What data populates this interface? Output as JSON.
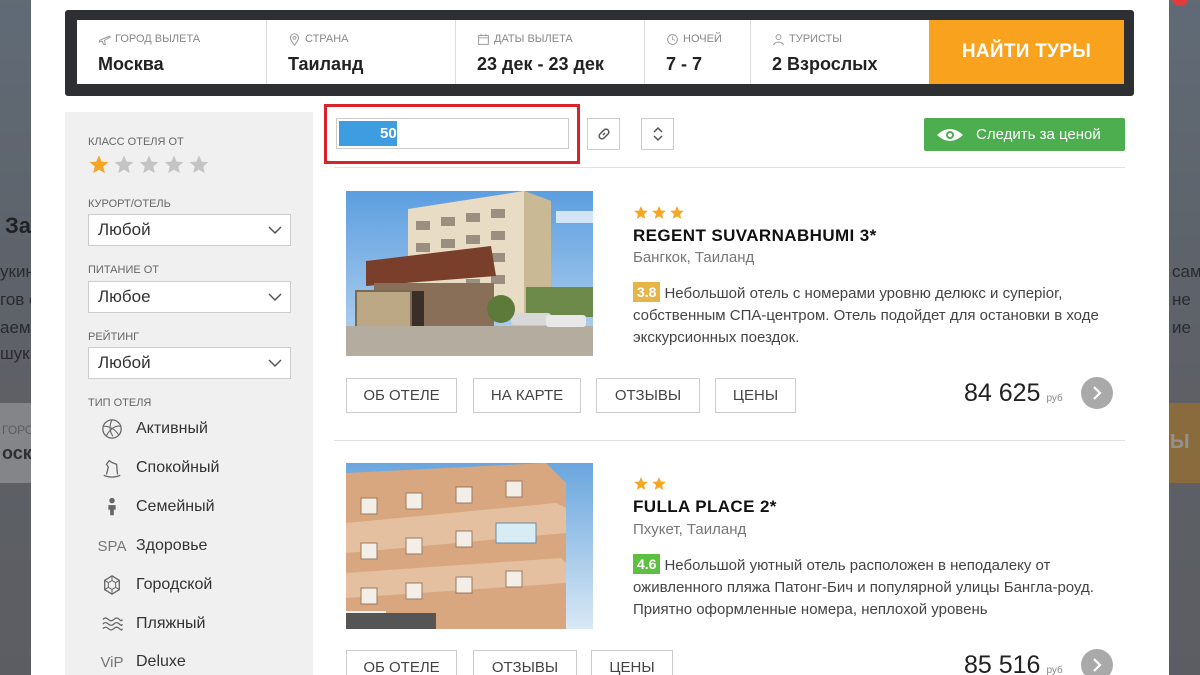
{
  "background_page": {
    "title_fragment": "За",
    "left_lines": [
      "укин",
      "гов с",
      "аем",
      "шук"
    ],
    "right_lines": [
      "самс",
      "не",
      "ие",
      ""
    ],
    "bar_label": "ГОРОД",
    "bar_value": "оск",
    "bar_button_fragment": "Ы"
  },
  "search": {
    "fields": [
      {
        "label": "ГОРОД ВЫЛЕТА",
        "value": "Москва",
        "icon": "plane-icon"
      },
      {
        "label": "СТРАНА",
        "value": "Таиланд",
        "icon": "map-pin-icon"
      },
      {
        "label": "ДАТЫ ВЫЛЕТА",
        "value": "23 дек - 23 дек",
        "icon": "calendar-icon"
      },
      {
        "label": "НОЧЕЙ",
        "value": "7 - 7",
        "icon": "clock-icon"
      },
      {
        "label": "ТУРИСТЫ",
        "value": "2 Взрослых",
        "icon": "user-icon"
      }
    ],
    "button": "НАЙТИ ТУРЫ"
  },
  "sidebar": {
    "hotel_class_label": "КЛАСС ОТЕЛЯ ОТ",
    "hotel_class_selected": 1,
    "hotel_class_max": 5,
    "resort_label": "КУРОРТ/ОТЕЛЬ",
    "resort_value": "Любой",
    "meal_label": "ПИТАНИЕ ОТ",
    "meal_value": "Любое",
    "rating_label": "РЕЙТИНГ",
    "rating_value": "Любой",
    "type_label": "ТИП ОТЕЛЯ",
    "types": [
      {
        "label": "Активный",
        "icon": "volleyball-icon"
      },
      {
        "label": "Спокойный",
        "icon": "rocking-horse-icon"
      },
      {
        "label": "Семейный",
        "icon": "child-icon"
      },
      {
        "label": "Здоровье",
        "icon": "SPA"
      },
      {
        "label": "Городской",
        "icon": "city-icon"
      },
      {
        "label": "Пляжный",
        "icon": "waves-icon"
      },
      {
        "label": "Deluxe",
        "icon": "ViP"
      }
    ]
  },
  "toolbar": {
    "progress": 0.5,
    "progress_label": "50%",
    "link_icon": "link-icon",
    "sort_icon": "sort-arrows-icon",
    "watch_label": "Следить за ценой",
    "watch_icon": "eye-icon"
  },
  "hotels": [
    {
      "stars": 3,
      "name": "REGENT SUVARNABHUMI 3*",
      "location": "Бангкок, Таиланд",
      "score": "3.8",
      "score_color": "#e6b54a",
      "description": "Небольшой отель с номерами уровню делюкс и суперior, собственным СПА-центром. Отель подойдет для остановки в ходе экскурсионных поездок.",
      "buttons": [
        "ОБ ОТЕЛЕ",
        "НА КАРТЕ",
        "ОТЗЫВЫ",
        "ЦЕНЫ"
      ],
      "price": "84 625",
      "currency": "РУБ"
    },
    {
      "stars": 2,
      "name": "FULLA PLACE 2*",
      "location": "Пхукет, Таиланд",
      "score": "4.6",
      "score_color": "#5dc040",
      "description": "Небольшой уютный отель расположен в неподалеку от оживленного пляжа Патонг-Бич и популярной улицы Бангла-роуд. Приятно оформленные номера, неплохой уровень",
      "buttons": [
        "ОБ ОТЕЛЕ",
        "ОТЗЫВЫ",
        "ЦЕНЫ"
      ],
      "price": "85 516",
      "currency": "РУБ"
    }
  ],
  "colors": {
    "accent_orange": "#f9a21d",
    "progress_blue": "#3e9de0",
    "watch_green": "#4cae4f",
    "star_active": "#f5a623",
    "star_inactive": "#c4c4c4",
    "highlight_red": "#d8232a"
  }
}
